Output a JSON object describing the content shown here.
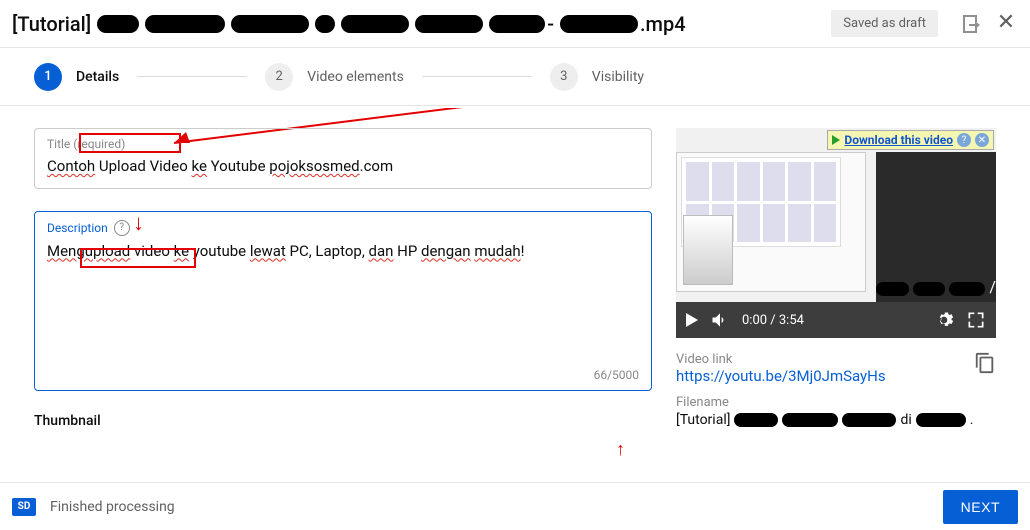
{
  "header": {
    "title_prefix": "[Tutorial]",
    "title_suffix": ".mp4",
    "saved_badge": "Saved as draft"
  },
  "stepper": {
    "steps": [
      {
        "num": "1",
        "label": "Details"
      },
      {
        "num": "2",
        "label": "Video elements"
      },
      {
        "num": "3",
        "label": "Visibility"
      }
    ]
  },
  "title_field": {
    "label": "Title (required)",
    "value_parts": {
      "a": "Contoh",
      "b": " Upload Video ",
      "c": "ke",
      "d": " Youtube ",
      "e": "pojoksosmed",
      "f": ".com"
    }
  },
  "desc_field": {
    "label": "Description",
    "value_parts": {
      "a": "Mengupload",
      "b": " video ",
      "c": "ke",
      "d": " youtube ",
      "e": "lewat",
      "f": " PC, Laptop, ",
      "g": "dan",
      "h": " HP ",
      "i": "dengan",
      "j": " ",
      "k": "mudah",
      "l": "!"
    },
    "char_count": "66/5000"
  },
  "thumbnail_heading": "Thumbnail",
  "download_bar": {
    "label": "Download this video"
  },
  "player": {
    "time": "0:00 / 3:54"
  },
  "video_meta": {
    "link_label": "Video link",
    "link": "https://youtu.be/3Mj0JmSayHs",
    "filename_label": "Filename",
    "filename_prefix": "[Tutorial]",
    "filename_mid": "di",
    "filename_suffix": "."
  },
  "footer": {
    "sd": "SD",
    "status": "Finished processing",
    "next": "NEXT"
  }
}
